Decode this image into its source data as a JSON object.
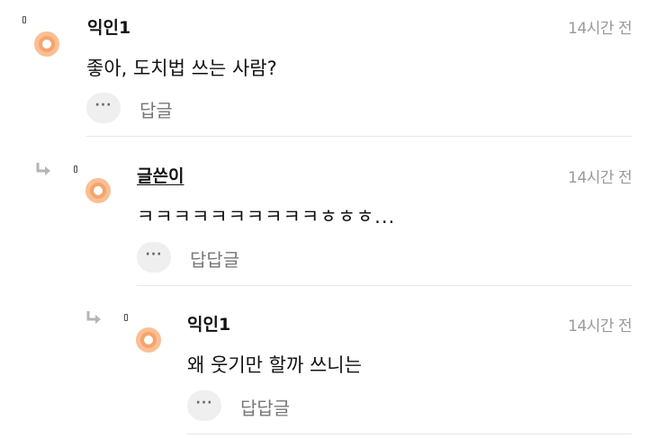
{
  "comments": [
    {
      "author": "익인1",
      "time": "14시간 전",
      "body": "좋아, 도치법 쓰는 사람?",
      "more_icon": "···",
      "reply_label": "답글"
    },
    {
      "author": "글쓴이",
      "time": "14시간 전",
      "body": "ㅋㅋㅋㅋㅋㅋㅋㅋㅋㅋㅎㅎㅎ...",
      "more_icon": "···",
      "reply_label": "답답글"
    },
    {
      "author": "익인1",
      "time": "14시간 전",
      "body": "왜 웃기만 할까 쓰니는",
      "more_icon": "···",
      "reply_label": "답답글"
    }
  ],
  "colors": {
    "avatar": "#f6a46e",
    "avatar_ring": "#fbbf93",
    "time": "#999999",
    "divider": "#e6e6e6"
  },
  "icons": {
    "reply_arrow": "reply-arrow-icon",
    "more": "more-dots-icon",
    "avatar": "avatar-icon",
    "marker": "marker-icon"
  }
}
